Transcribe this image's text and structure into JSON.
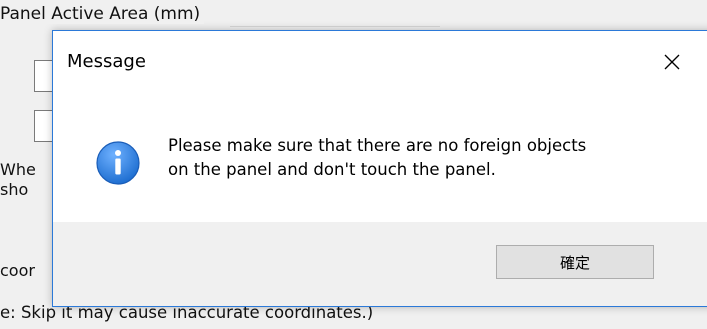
{
  "background": {
    "groupbox_label": "Panel Active Area (mm)",
    "text_line_1": "Whe",
    "text_line_2": "sho",
    "text_line_3": "coor",
    "text_line_4": "e: Skip it may cause inaccurate coordinates.)"
  },
  "dialog": {
    "title": "Message",
    "message_line_1": "Please make sure that there are no foreign objects",
    "message_line_2": "on the panel and don't touch the panel.",
    "ok_button_label": "確定",
    "icon": "info-icon"
  },
  "colors": {
    "dialog_border": "#2b79d8",
    "info_icon_blue": "#1f6fd1",
    "footer_bg": "#f0f0f0",
    "button_bg": "#e1e1e1"
  }
}
